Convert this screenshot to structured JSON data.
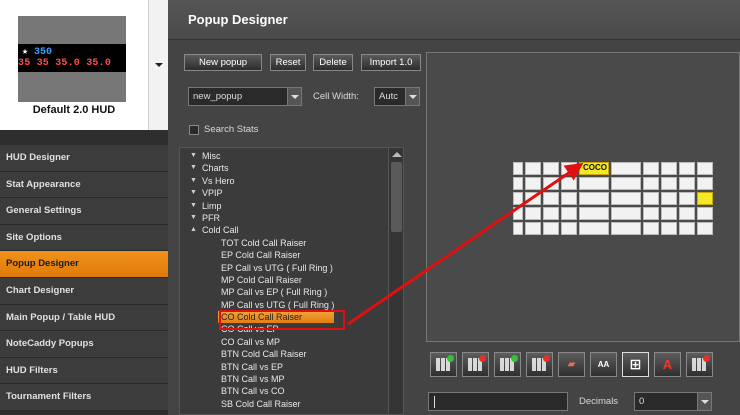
{
  "hud": {
    "preview_row1": "350",
    "preview_row2": "35 35 35.0 35.0",
    "name": "Default 2.0 HUD"
  },
  "sidebar": {
    "items": [
      {
        "label": "HUD Designer"
      },
      {
        "label": "Stat Appearance"
      },
      {
        "label": "General Settings"
      },
      {
        "label": "Site Options"
      },
      {
        "label": "Popup Designer",
        "active": true
      },
      {
        "label": "Chart Designer"
      },
      {
        "label": "Main Popup / Table HUD"
      },
      {
        "label": "NoteCaddy Popups"
      },
      {
        "label": "HUD Filters"
      },
      {
        "label": "Tournament Filters"
      }
    ]
  },
  "main": {
    "title": "Popup Designer",
    "buttons": {
      "new_popup": "New popup",
      "reset": "Reset",
      "delete": "Delete",
      "import": "Import 1.0"
    },
    "popup_select": "new_popup",
    "cell_width_label": "Cell Width:",
    "cell_width_value": "Autc",
    "search_stats_label": "Search Stats",
    "tree": {
      "categories": [
        "Misc",
        "Charts",
        "Vs Hero",
        "VPIP",
        "Limp",
        "PFR",
        "Cold Call"
      ],
      "cold_call_items": [
        "TOT Cold Call Raiser",
        "EP Cold Call Raiser",
        "EP Call vs UTG ( Full Ring )",
        "MP Cold Call Raiser",
        "MP Call vs EP ( Full Ring )",
        "MP Call vs UTG ( Full Ring )",
        "CO Cold Call Raiser",
        "CO Call vs EP",
        "CO Call vs MP",
        "BTN Cold Call Raiser",
        "BTN Call vs EP",
        "BTN Call vs MP",
        "BTN Call vs CO",
        "SB Cold Call Raiser"
      ],
      "selected": "CO Cold Call Raiser"
    },
    "canvas_cell_label": "COCO",
    "decimals_label": "Decimals",
    "decimals_value": "0",
    "text_field": "",
    "toolbar_glyphs": {
      "aa": "AA",
      "a": "A"
    }
  },
  "colors": {
    "accent_orange": "#f1921c",
    "highlight_red": "#e01010",
    "cell_yellow": "#f5e82a"
  }
}
